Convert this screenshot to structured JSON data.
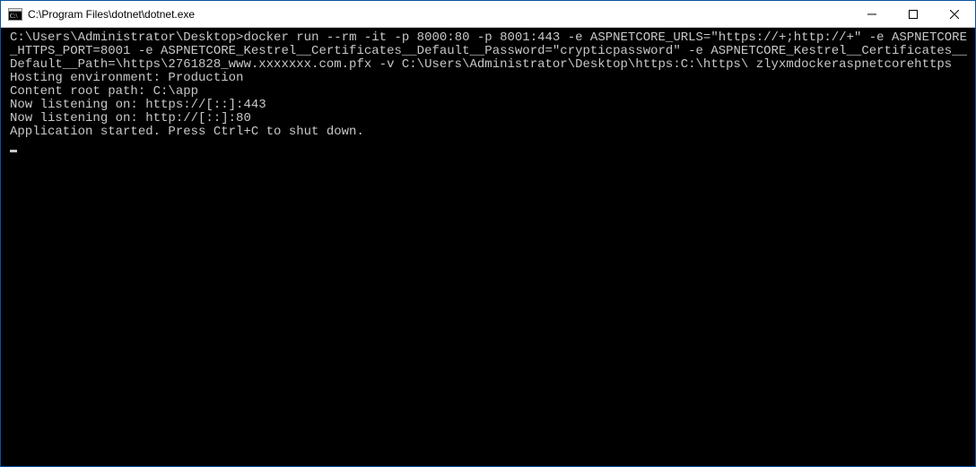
{
  "window": {
    "title": "C:\\Program Files\\dotnet\\dotnet.exe",
    "controls": {
      "minimize": "minimize",
      "maximize": "maximize",
      "close": "close"
    }
  },
  "terminal": {
    "prompt": "C:\\Users\\Administrator\\Desktop>",
    "command": "docker run --rm -it -p 8000:80 -p 8001:443 -e ASPNETCORE_URLS=\"https://+;http://+\" -e ASPNETCORE_HTTPS_PORT=8001 -e ASPNETCORE_Kestrel__Certificates__Default__Password=\"crypticpassword\" -e ASPNETCORE_Kestrel__Certificates__Default__Path=\\https\\2761828_www.xxxxxxx.com.pfx -v C:\\Users\\Administrator\\Desktop\\https:C:\\https\\ zlyxmdockeraspnetcorehttps",
    "output": [
      "Hosting environment: Production",
      "Content root path: C:\\app",
      "Now listening on: https://[::]:443",
      "Now listening on: http://[::]:80",
      "Application started. Press Ctrl+C to shut down."
    ]
  }
}
